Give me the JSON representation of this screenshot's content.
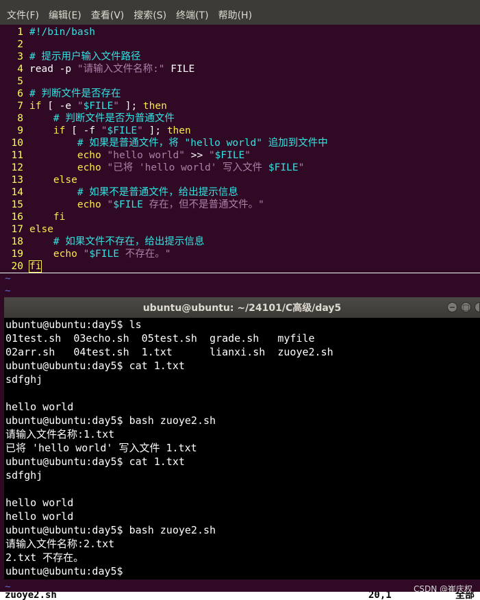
{
  "menubar": {
    "items": [
      "文件(F)",
      "编辑(E)",
      "查看(V)",
      "搜索(S)",
      "终端(T)",
      "帮助(H)"
    ]
  },
  "editor": {
    "lines": [
      {
        "n": "1",
        "segs": [
          {
            "t": "#!/bin/bash",
            "c": "comment"
          }
        ]
      },
      {
        "n": "2",
        "segs": []
      },
      {
        "n": "3",
        "segs": [
          {
            "t": "# 提示用户输入文件路径",
            "c": "comment"
          }
        ]
      },
      {
        "n": "4",
        "segs": [
          {
            "t": "read -p ",
            "c": "plain"
          },
          {
            "t": "\"请输入文件名称:\"",
            "c": "str"
          },
          {
            "t": " FILE",
            "c": "plain"
          }
        ]
      },
      {
        "n": "5",
        "segs": []
      },
      {
        "n": "6",
        "segs": [
          {
            "t": "# 判断文件是否存在",
            "c": "comment"
          }
        ]
      },
      {
        "n": "7",
        "segs": [
          {
            "t": "if",
            "c": "kw"
          },
          {
            "t": " [ -e ",
            "c": "plain"
          },
          {
            "t": "\"",
            "c": "str"
          },
          {
            "t": "$FILE",
            "c": "var"
          },
          {
            "t": "\"",
            "c": "str"
          },
          {
            "t": " ]; ",
            "c": "plain"
          },
          {
            "t": "then",
            "c": "kw"
          }
        ]
      },
      {
        "n": "8",
        "segs": [
          {
            "t": "    # 判断文件是否为普通文件",
            "c": "comment"
          }
        ]
      },
      {
        "n": "9",
        "segs": [
          {
            "t": "    if",
            "c": "kw"
          },
          {
            "t": " [ -f ",
            "c": "plain"
          },
          {
            "t": "\"",
            "c": "str"
          },
          {
            "t": "$FILE",
            "c": "var"
          },
          {
            "t": "\"",
            "c": "str"
          },
          {
            "t": " ]; ",
            "c": "plain"
          },
          {
            "t": "then",
            "c": "kw"
          }
        ]
      },
      {
        "n": "10",
        "segs": [
          {
            "t": "        # 如果是普通文件，将 \"hello world\" 追加到文件中",
            "c": "comment"
          }
        ]
      },
      {
        "n": "11",
        "segs": [
          {
            "t": "        echo",
            "c": "kw"
          },
          {
            "t": " \"hello world\"",
            "c": "str"
          },
          {
            "t": " >> ",
            "c": "plain"
          },
          {
            "t": "\"",
            "c": "str"
          },
          {
            "t": "$FILE",
            "c": "var"
          },
          {
            "t": "\"",
            "c": "str"
          }
        ]
      },
      {
        "n": "12",
        "segs": [
          {
            "t": "        echo",
            "c": "kw"
          },
          {
            "t": " \"已将 'hello world' 写入文件 ",
            "c": "str"
          },
          {
            "t": "$FILE",
            "c": "var"
          },
          {
            "t": "\"",
            "c": "str"
          }
        ]
      },
      {
        "n": "13",
        "segs": [
          {
            "t": "    else",
            "c": "kw"
          }
        ]
      },
      {
        "n": "14",
        "segs": [
          {
            "t": "        # 如果不是普通文件，给出提示信息",
            "c": "comment"
          }
        ]
      },
      {
        "n": "15",
        "segs": [
          {
            "t": "        echo",
            "c": "kw"
          },
          {
            "t": " \"",
            "c": "str"
          },
          {
            "t": "$FILE",
            "c": "var"
          },
          {
            "t": " 存在，但不是普通文件。\"",
            "c": "str"
          }
        ]
      },
      {
        "n": "16",
        "segs": [
          {
            "t": "    fi",
            "c": "kw"
          }
        ]
      },
      {
        "n": "17",
        "segs": [
          {
            "t": "else",
            "c": "kw"
          }
        ]
      },
      {
        "n": "18",
        "segs": [
          {
            "t": "    # 如果文件不存在，给出提示信息",
            "c": "comment"
          }
        ]
      },
      {
        "n": "19",
        "segs": [
          {
            "t": "    echo",
            "c": "kw"
          },
          {
            "t": " \"",
            "c": "str"
          },
          {
            "t": "$FILE",
            "c": "var"
          },
          {
            "t": " 不存在。\"",
            "c": "str"
          }
        ]
      },
      {
        "n": "20",
        "segs": [
          {
            "t": "fi",
            "c": "kw"
          }
        ],
        "cursor": true
      }
    ],
    "tilde": "~"
  },
  "terminal": {
    "title": "ubuntu@ubuntu: ~/24101/C高级/day5",
    "buttons": {
      "minimize": "−",
      "maximize": "□",
      "close": "×"
    },
    "lines": [
      "ubuntu@ubuntu:day5$ ls",
      "01test.sh  03echo.sh  05test.sh  grade.sh   myfile",
      "02arr.sh   04test.sh  1.txt      lianxi.sh  zuoye2.sh",
      "ubuntu@ubuntu:day5$ cat 1.txt",
      "sdfghj",
      "",
      "hello world",
      "ubuntu@ubuntu:day5$ bash zuoye2.sh",
      "请输入文件名称:1.txt",
      "已将 'hello world' 写入文件 1.txt",
      "ubuntu@ubuntu:day5$ cat 1.txt",
      "sdfghj",
      "",
      "hello world",
      "hello world",
      "ubuntu@ubuntu:day5$ bash zuoye2.sh",
      "请输入文件名称:2.txt",
      "2.txt 不存在。",
      "ubuntu@ubuntu:day5$"
    ]
  },
  "statusbar": {
    "filename": "zuoye2.sh",
    "position": "20,1",
    "scroll": "全部"
  },
  "watermark": "CSDN @崔庆权"
}
